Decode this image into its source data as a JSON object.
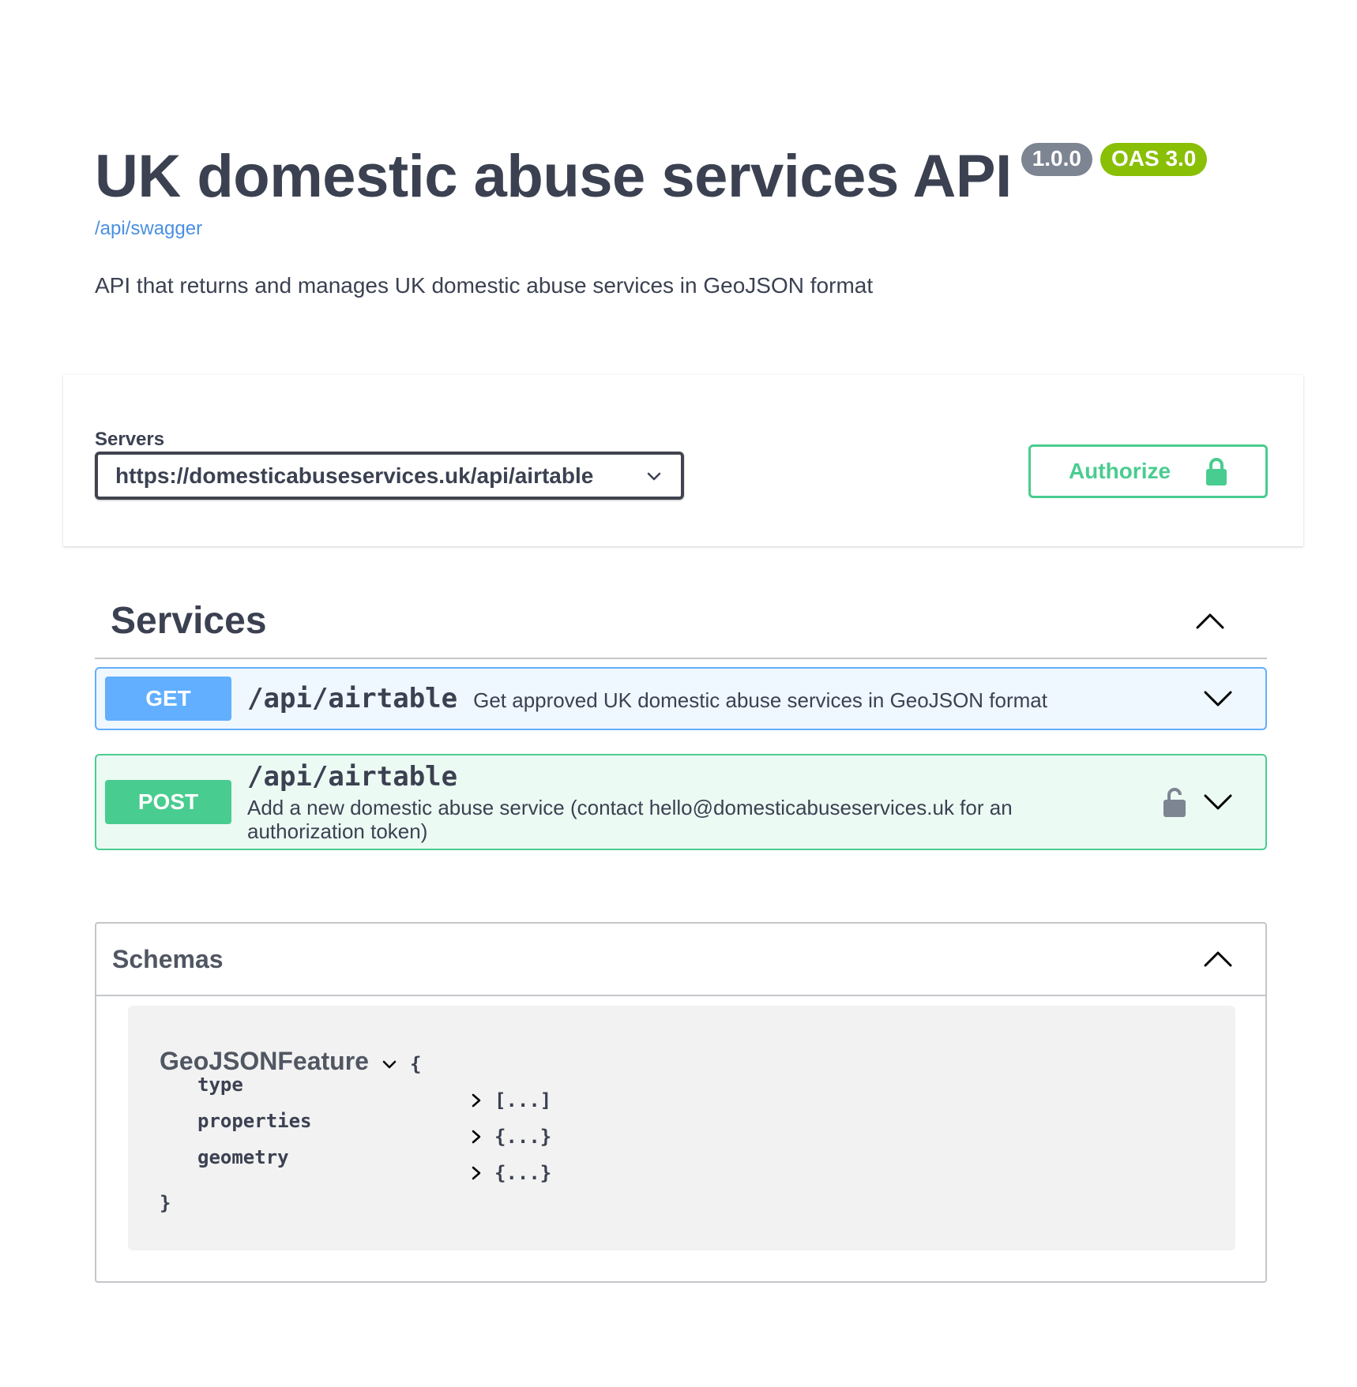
{
  "info": {
    "title": "UK domestic abuse services API",
    "version_badge": "1.0.0",
    "oas_badge": "OAS 3.0",
    "base_url": "/api/swagger",
    "description": "API that returns and manages UK domestic abuse services in GeoJSON format"
  },
  "servers": {
    "label": "Servers",
    "selected": "https://domesticabuseservices.uk/api/airtable"
  },
  "authorize": {
    "label": "Authorize"
  },
  "tag": {
    "name": "Services",
    "operations": [
      {
        "method": "GET",
        "path": "/api/airtable",
        "summary": "Get approved UK domestic abuse services in GeoJSON format"
      },
      {
        "method": "POST",
        "path": "/api/airtable",
        "summary": "Add a new domestic abuse service (contact hello@domesticabuseservices.uk for an authorization token)"
      }
    ]
  },
  "models": {
    "title": "Schemas",
    "model": {
      "name": "GeoJSONFeature",
      "open_brace": "{",
      "close_brace": "}",
      "properties": [
        {
          "name": "type",
          "value": "[...]"
        },
        {
          "name": "properties",
          "value": "{...}"
        },
        {
          "name": "geometry",
          "value": "{...}"
        }
      ]
    }
  },
  "colors": {
    "get": "#61affe",
    "post": "#49cc90",
    "version_badge": "#7d8492",
    "oas_badge": "#89bf04",
    "link": "#4990e2",
    "text": "#3b4151"
  },
  "icons": {
    "server_dropdown": "chevron-down-icon",
    "authorize": "lock-icon",
    "tag_toggle": "chevron-up-icon",
    "operation_toggle": "chevron-down-icon",
    "post_lock": "unlocked-icon",
    "models_toggle": "chevron-up-icon",
    "model_toggle": "chevron-down-icon",
    "property_expand": "chevron-right-icon"
  }
}
